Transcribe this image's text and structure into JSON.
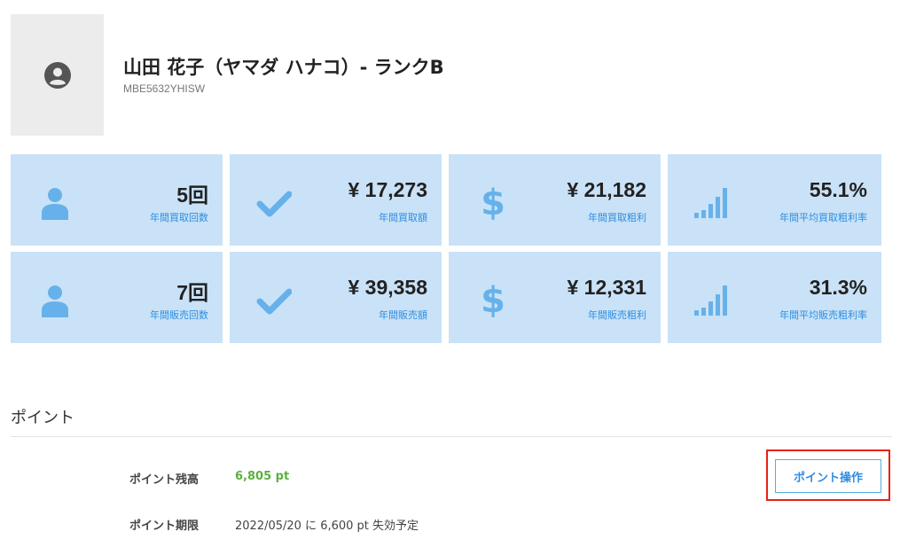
{
  "profile": {
    "name": "山田 花子（ヤマダ ハナコ）- ランクB",
    "member_id": "MBE5632YHISW",
    "avatar_icon": "user-circle-icon"
  },
  "stats": [
    {
      "value": "5回",
      "label": "年間買取回数",
      "icon": "user-icon"
    },
    {
      "value": "¥ 17,273",
      "label": "年間買取額",
      "icon": "check-icon"
    },
    {
      "value": "¥ 21,182",
      "label": "年間買取粗利",
      "icon": "dollar-icon"
    },
    {
      "value": "55.1%",
      "label": "年間平均買取粗利率",
      "icon": "signal-bars-icon"
    },
    {
      "value": "7回",
      "label": "年間販売回数",
      "icon": "user-icon"
    },
    {
      "value": "¥ 39,358",
      "label": "年間販売額",
      "icon": "check-icon"
    },
    {
      "value": "¥ 12,331",
      "label": "年間販売粗利",
      "icon": "dollar-icon"
    },
    {
      "value": "31.3%",
      "label": "年間平均販売粗利率",
      "icon": "signal-bars-icon"
    }
  ],
  "points": {
    "section_title": "ポイント",
    "balance_label": "ポイント残高",
    "balance_value": "6,805 pt",
    "expiry_label": "ポイント期限",
    "expiry_value": "2022/05/20 に 6,600 pt 失効予定",
    "operate_button": "ポイント操作"
  },
  "colors": {
    "card_bg": "#c9e2f7",
    "icon": "#67b1ea",
    "accent_blue": "#2f8de0",
    "balance_green": "#5db043",
    "highlight_red": "#e62117"
  }
}
